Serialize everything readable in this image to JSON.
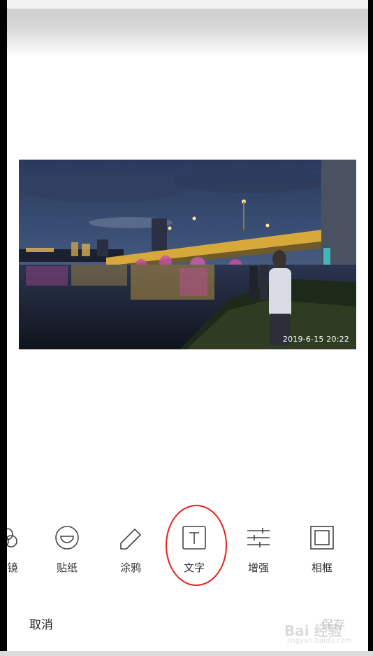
{
  "photo": {
    "timestamp": "2019-6-15 20:22"
  },
  "toolbar": {
    "items": [
      {
        "label": "镜",
        "icon": "filter-icon",
        "partial": true
      },
      {
        "label": "贴纸",
        "icon": "sticker-icon"
      },
      {
        "label": "涂鸦",
        "icon": "doodle-icon"
      },
      {
        "label": "文字",
        "icon": "text-icon",
        "highlighted": true
      },
      {
        "label": "增强",
        "icon": "adjust-sliders-icon"
      },
      {
        "label": "相框",
        "icon": "frame-icon"
      }
    ]
  },
  "actions": {
    "cancel_label": "取消",
    "save_label": "保存"
  },
  "watermark": {
    "main": "Bai 经验",
    "sub": "jingyan.baidu.com"
  },
  "colors": {
    "highlight_circle": "#e8211f",
    "bridge_lights": "#f5c93a"
  }
}
